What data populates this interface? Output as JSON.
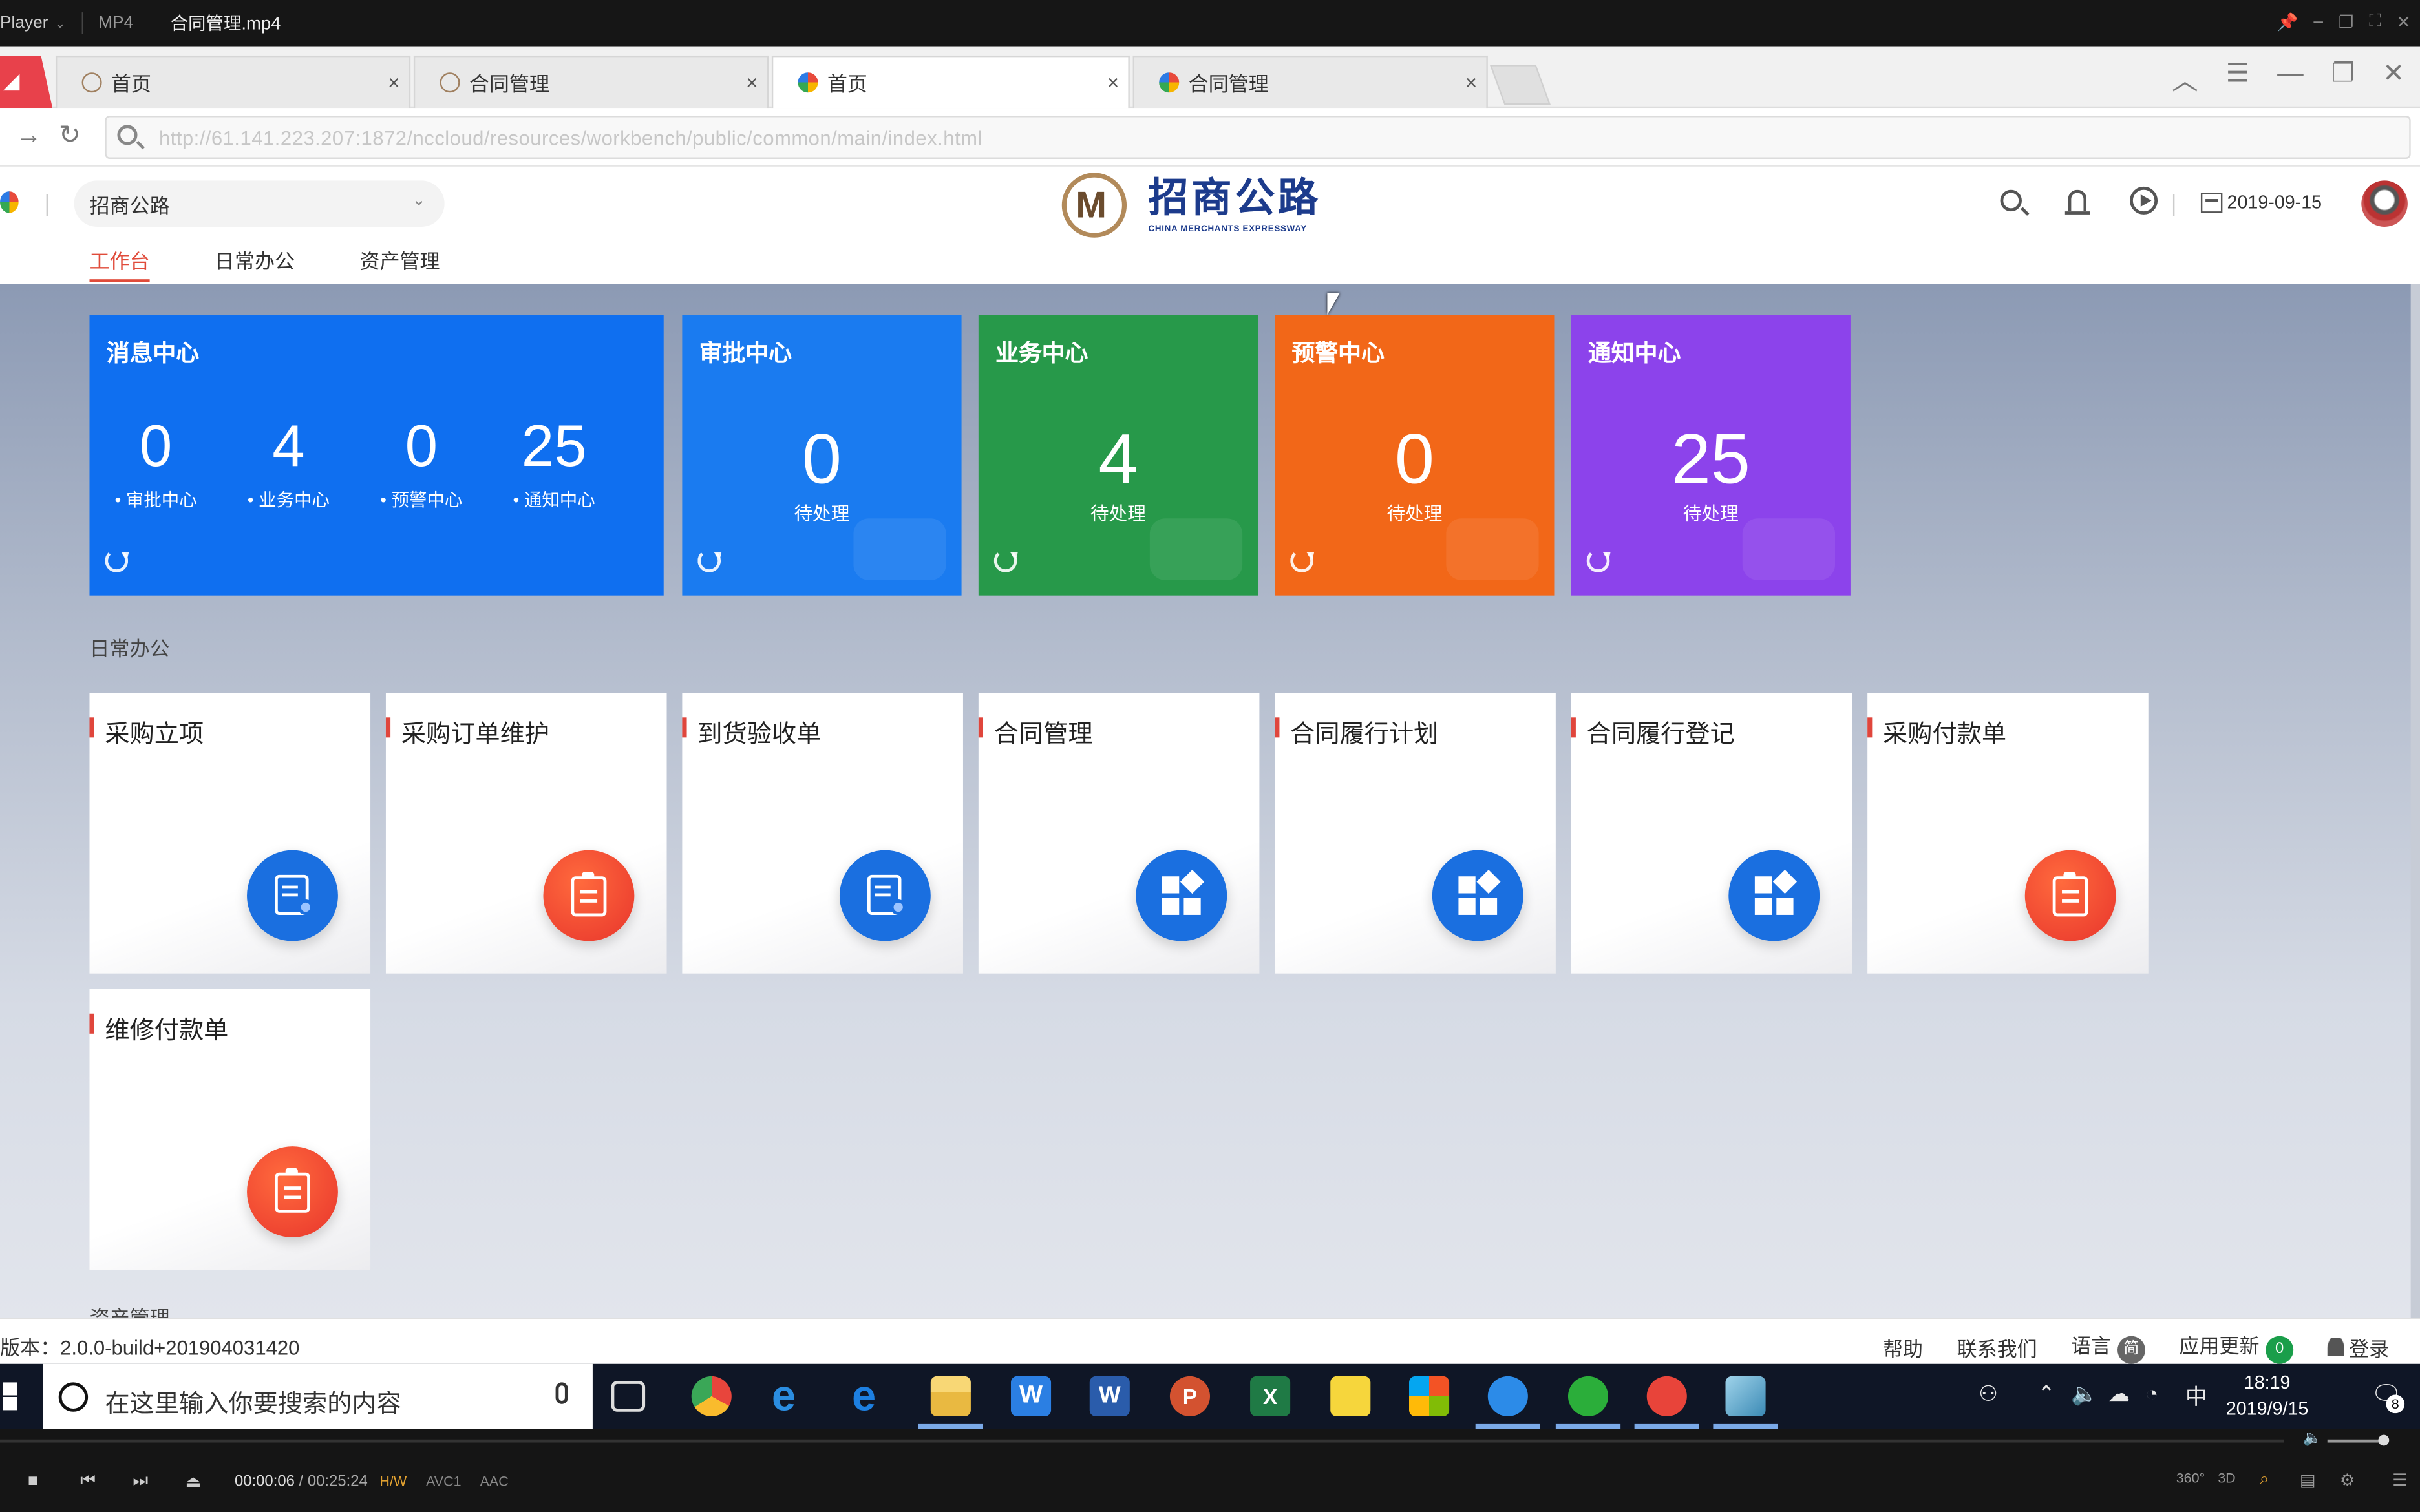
{
  "player": {
    "app_name": "Player",
    "format": "MP4",
    "filename": "合同管理.mp4"
  },
  "browser": {
    "tabs": [
      {
        "label": "首页",
        "icon": "logo-m-icon",
        "active": false
      },
      {
        "label": "合同管理",
        "icon": "logo-m-icon",
        "active": false
      },
      {
        "label": "首页",
        "icon": "pinwheel-icon",
        "active": true
      },
      {
        "label": "合同管理",
        "icon": "pinwheel-icon",
        "active": false
      }
    ],
    "tab_close": "×",
    "url": "http://61.141.223.207:1872/nccloud/resources/workbench/public/common/main/index.html"
  },
  "header": {
    "org": "招商公路",
    "brand_cn": "招商公路",
    "brand_en": "CHINA MERCHANTS EXPRESSWAY",
    "date": "2019-09-15"
  },
  "nav": {
    "tabs": [
      "工作台",
      "日常办公",
      "资产管理"
    ],
    "active_index": 0
  },
  "message_center": {
    "title": "消息中心",
    "stats": [
      {
        "value": "0",
        "label": "• 审批中心"
      },
      {
        "value": "4",
        "label": "• 业务中心"
      },
      {
        "value": "0",
        "label": "• 预警中心"
      },
      {
        "value": "25",
        "label": "• 通知中心"
      }
    ],
    "color": "#0f6ff0"
  },
  "centers": [
    {
      "title": "审批中心",
      "count": "0",
      "label": "待处理",
      "color": "#1a7bf0"
    },
    {
      "title": "业务中心",
      "count": "4",
      "label": "待处理",
      "color": "#27994a"
    },
    {
      "title": "预警中心",
      "count": "0",
      "label": "待处理",
      "color": "#f26718"
    },
    {
      "title": "通知中心",
      "count": "25",
      "label": "待处理",
      "color": "#8c43eb"
    }
  ],
  "daily_office": {
    "section_title": "日常办公",
    "apps": [
      {
        "name": "采购立项",
        "icon": "document-check-icon"
      },
      {
        "name": "采购订单维护",
        "icon": "clipboard-icon"
      },
      {
        "name": "到货验收单",
        "icon": "document-check-icon"
      },
      {
        "name": "合同管理",
        "icon": "apps-grid-icon"
      },
      {
        "name": "合同履行计划",
        "icon": "apps-grid-icon"
      },
      {
        "name": "合同履行登记",
        "icon": "apps-grid-icon"
      },
      {
        "name": "采购付款单",
        "icon": "clipboard-icon"
      },
      {
        "name": "维修付款单",
        "icon": "clipboard-icon"
      }
    ]
  },
  "asset_section_title": "资产管理",
  "status": {
    "version": "版本：2.0.0-build+201904031420",
    "help": "帮助",
    "contact": "联系我们",
    "language": "语言",
    "language_badge": "简",
    "update": "应用更新",
    "update_count": "0",
    "login": "登录"
  },
  "taskbar": {
    "search_placeholder": "在这里输入你要搜索的内容",
    "ime": "中",
    "time": "18:19",
    "date": "2019/9/15",
    "notifications": "8"
  },
  "playback": {
    "elapsed": "00:00:06",
    "total": "/ 00:25:24",
    "codecs": [
      "H/W",
      "AVC1",
      "AAC"
    ],
    "extras": [
      "360°",
      "3D"
    ]
  }
}
